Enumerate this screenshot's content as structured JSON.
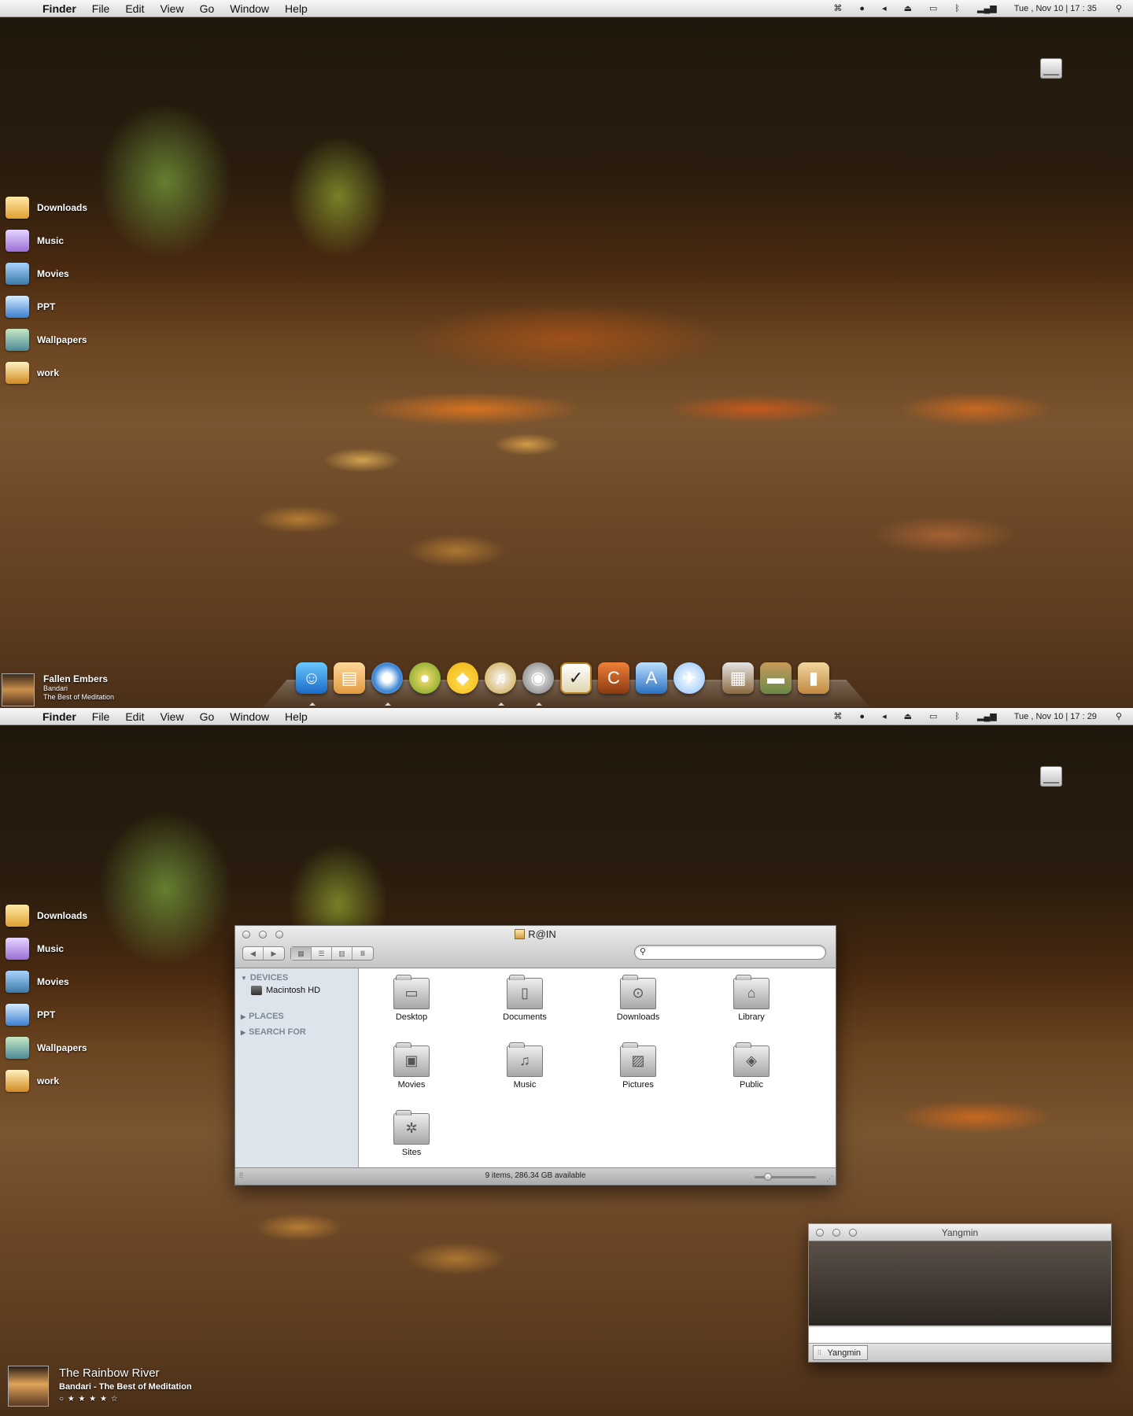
{
  "menubar": {
    "items": [
      "Finder",
      "File",
      "Edit",
      "View",
      "Go",
      "Window",
      "Help"
    ],
    "apple_icon": "apple-icon",
    "status_icons": [
      "app-icon",
      "chat-icon",
      "volume-icon",
      "eject-icon",
      "battery-icon",
      "bluetooth-icon",
      "wifi-icon"
    ],
    "clock_top": "Tue , Nov 10 | 17 : 35",
    "clock_bottom": "Tue , Nov 10 | 17 : 29",
    "spotlight_icon": "search-icon"
  },
  "desktop": {
    "items": [
      "Downloads",
      "Music",
      "Movies",
      "PPT",
      "Wallpapers",
      "work"
    ]
  },
  "now_playing_top": {
    "title": "Fallen Embers",
    "artist": "Bandari",
    "album": "The Best of Meditation"
  },
  "dock": {
    "icons": [
      "finder-icon",
      "preview-icon",
      "safari-icon",
      "firefox-icon",
      "cyberduck-icon",
      "itunes-icon",
      "iphoto-icon",
      "tasks-icon",
      "coda-icon",
      "xcode-icon",
      "mail-icon",
      "applications-stack-icon",
      "documents-stack-icon",
      "downloads-stack-icon"
    ]
  },
  "finder": {
    "title": "R@IN",
    "search_placeholder": "",
    "sidebar": {
      "devices": "DEVICES",
      "device_item": "Macintosh HD",
      "places": "PLACES",
      "search_for": "SEARCH FOR"
    },
    "folders": [
      "Desktop",
      "Documents",
      "Downloads",
      "Library",
      "Movies",
      "Music",
      "Pictures",
      "Public",
      "Sites"
    ],
    "status": "9 items, 286.34 GB available"
  },
  "yangmin": {
    "title": "Yangmin",
    "tab": "Yangmin"
  },
  "now_playing_bottom": {
    "title": "The Rainbow River",
    "subtitle": "Bandari - The Best of Meditation",
    "rating": "○ ★ ★ ★ ★ ☆"
  },
  "colors": {
    "menubar": "#e6e6e6",
    "sidebar": "#dde4eb"
  }
}
